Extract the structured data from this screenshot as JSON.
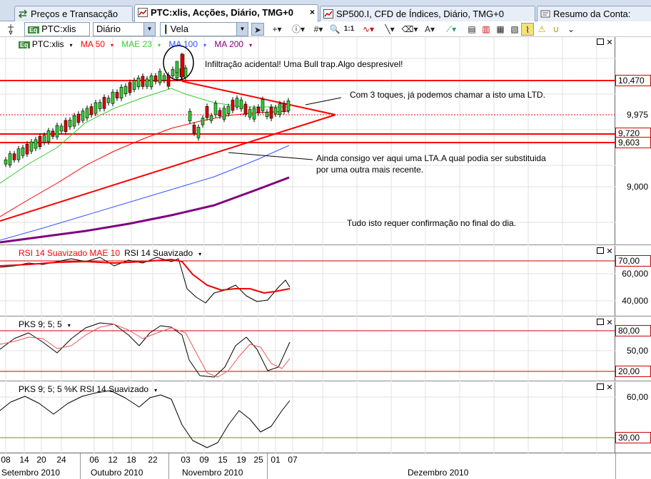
{
  "tabs": [
    {
      "label": "Preços e Transacção",
      "active": false,
      "close": ""
    },
    {
      "label": "PTC:xlis, Acções, Diário, TMG+0",
      "active": true,
      "close": "×"
    },
    {
      "label": "SP500.I, CFD de Índices, Diário, TMG+0",
      "active": false,
      "close": ""
    },
    {
      "label": "Resumo da Conta:",
      "active": false,
      "close": ""
    }
  ],
  "toolbar": {
    "symbol_value": "PTC:xlis",
    "symbol_badge": "Eq",
    "period_value": "Diário",
    "chart_type_value": "Vela",
    "ratio_label": "1:1"
  },
  "price_panel": {
    "legend": {
      "symbol": "PTC:xlis",
      "symbol_badge": "Eq",
      "ma50": "MA 50",
      "mae23": "MAE 23",
      "ma100": "MA 100",
      "ma200": "MA 200"
    },
    "ticks": [
      "9,000"
    ],
    "levels": [
      "10,470",
      "9,975",
      "9,720",
      "9,603"
    ],
    "colors": {
      "ma50": "#ff0000",
      "mae23": "#33cc33",
      "ma100": "#3355ff",
      "ma200": "#800080",
      "level": "#ff0000"
    }
  },
  "annotations": {
    "bull_trap": "Infiltração acidental! Uma Bull trap.Algo despresivel!",
    "ltd": "Com 3 toques, já podemos chamar a isto uma LTD.",
    "lta_1": "Ainda consigo ver aqui uma LTA.A qual podia ser substituida",
    "lta_2": "por uma outra mais recente.",
    "confirm": "Tudo isto requer confirmação no final do dia."
  },
  "rsi_panel": {
    "legend_1": "RSI 14 Suavizado MAE 10",
    "legend_2": "RSI 14 Suavizado",
    "ticks": [
      "60,000",
      "40,000"
    ],
    "level": "70,00"
  },
  "pks_panel": {
    "legend": "PKS 9; 5; 5",
    "ticks": [
      "50,00"
    ],
    "levels": [
      "80,00",
      "20,00"
    ]
  },
  "pksrsi_panel": {
    "legend": "PKS 9; 5; 5 %K RSI 14 Suavizado",
    "ticks": [
      "60,00"
    ],
    "level": "30,00"
  },
  "date_axis": {
    "days": [
      "08",
      "14",
      "20",
      "24",
      "06",
      "12",
      "18",
      "22",
      "03",
      "09",
      "15",
      "19",
      "25",
      "01",
      "07"
    ],
    "months": [
      "Setembro 2010",
      "Outubro 2010",
      "Novembro 2010",
      "Dezembro 2010"
    ]
  }
}
